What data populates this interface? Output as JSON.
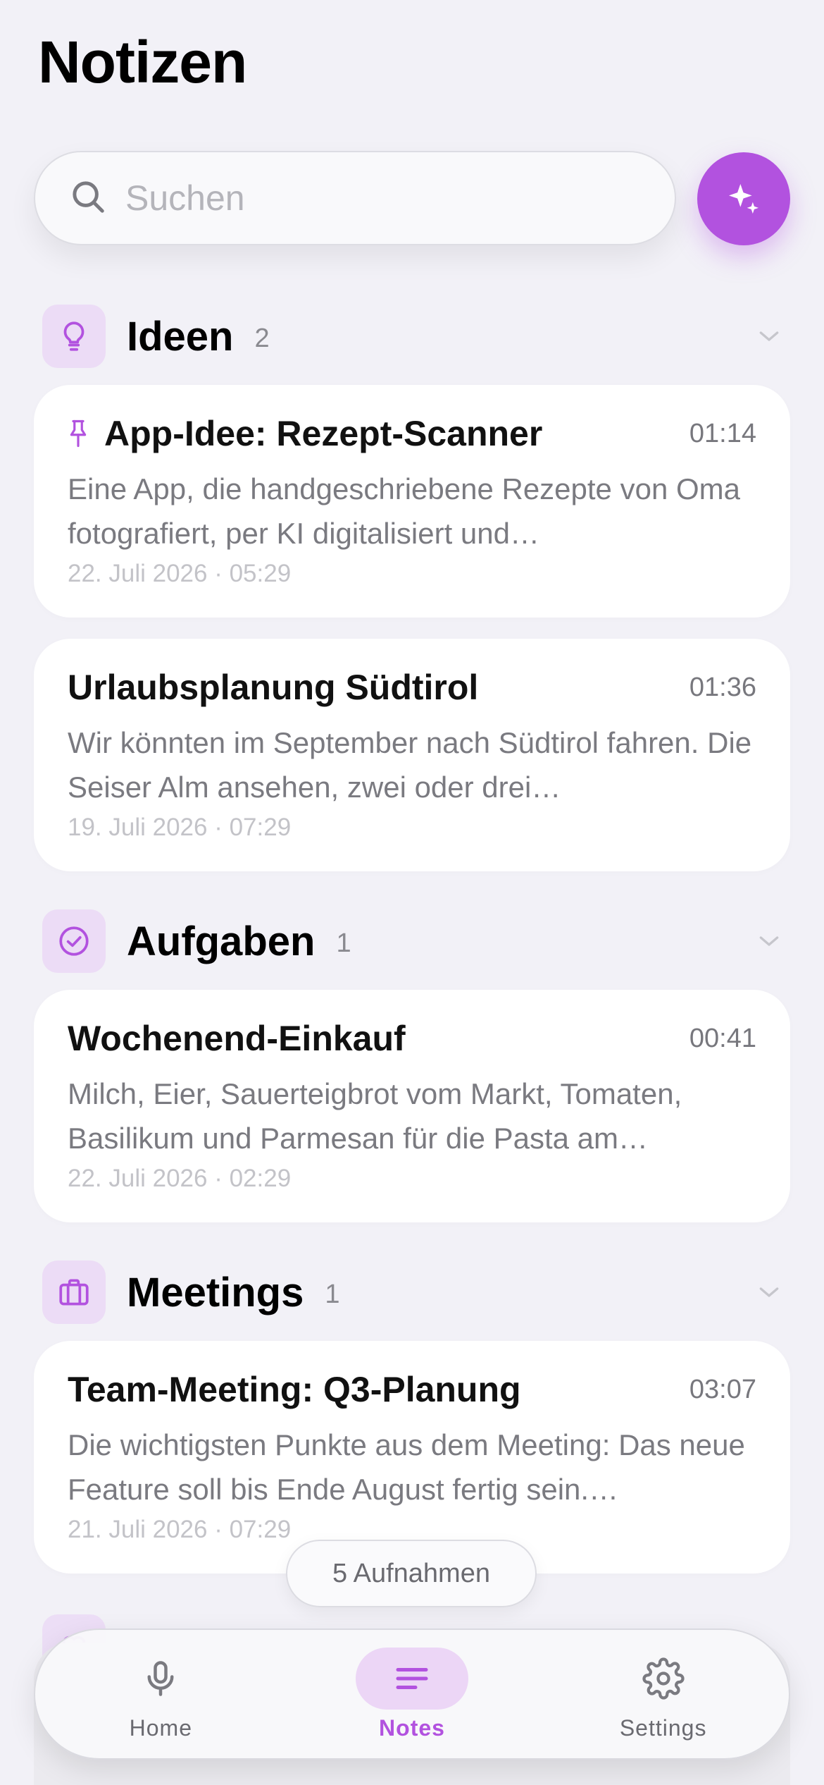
{
  "header": {
    "title": "Notizen"
  },
  "search": {
    "placeholder": "Suchen"
  },
  "colors": {
    "accent": "#b252df",
    "accent_soft": "#ecdcf6",
    "background": "#f2f1f7"
  },
  "sections": [
    {
      "title": "Ideen",
      "count": "2",
      "icon": "lightbulb-icon",
      "notes": [
        {
          "pinned": true,
          "title": "App-Idee: Rezept-Scanner",
          "duration": "01:14",
          "preview": "Eine App, die handgeschriebene Rezepte von Oma fotografiert, per KI digitalisiert und…",
          "date": "22. Juli 2026 · 05:29"
        },
        {
          "pinned": false,
          "title": "Urlaubsplanung Südtirol",
          "duration": "01:36",
          "preview": "Wir könnten im September nach Südtirol fahren. Die Seiser Alm ansehen, zwei oder drei…",
          "date": "19. Juli 2026 · 07:29"
        }
      ]
    },
    {
      "title": "Aufgaben",
      "count": "1",
      "icon": "check-circle-icon",
      "notes": [
        {
          "pinned": false,
          "title": "Wochenend-Einkauf",
          "duration": "00:41",
          "preview": "Milch, Eier, Sauerteigbrot vom Markt, Tomaten, Basilikum und Parmesan für die Pasta am…",
          "date": "22. Juli 2026 · 02:29"
        }
      ]
    },
    {
      "title": "Meetings",
      "count": "1",
      "icon": "briefcase-icon",
      "notes": [
        {
          "pinned": false,
          "title": "Team-Meeting: Q3-Planung",
          "duration": "03:07",
          "preview": "Die wichtigsten Punkte aus dem Meeting: Das neue Feature soll bis Ende August fertig sein.…",
          "date": "21. Juli 2026 · 07:29"
        }
      ]
    }
  ],
  "partial_section": {
    "icon": "heart-icon"
  },
  "recordings_pill": {
    "label": "5 Aufnahmen"
  },
  "tabbar": {
    "tabs": [
      {
        "label": "Home",
        "icon": "microphone-icon",
        "active": false
      },
      {
        "label": "Notes",
        "icon": "notes-lines-icon",
        "active": true
      },
      {
        "label": "Settings",
        "icon": "gear-icon",
        "active": false
      }
    ]
  }
}
